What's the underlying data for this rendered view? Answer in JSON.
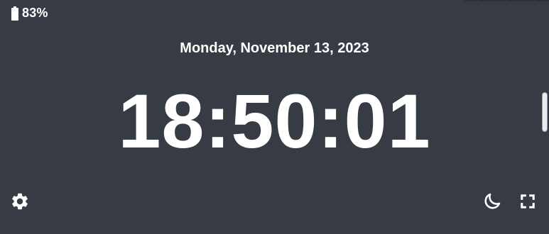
{
  "status": {
    "battery_label": "83%",
    "battery_level": 0.83,
    "battery_icon": "battery-icon"
  },
  "clock": {
    "date": "Monday, November 13, 2023",
    "time": "18:50:01"
  },
  "controls": {
    "settings_icon": "gear-icon",
    "night_mode_icon": "moon-icon",
    "fullscreen_icon": "fullscreen-icon"
  },
  "colors": {
    "background": "#373b44",
    "foreground": "#ffffff"
  }
}
